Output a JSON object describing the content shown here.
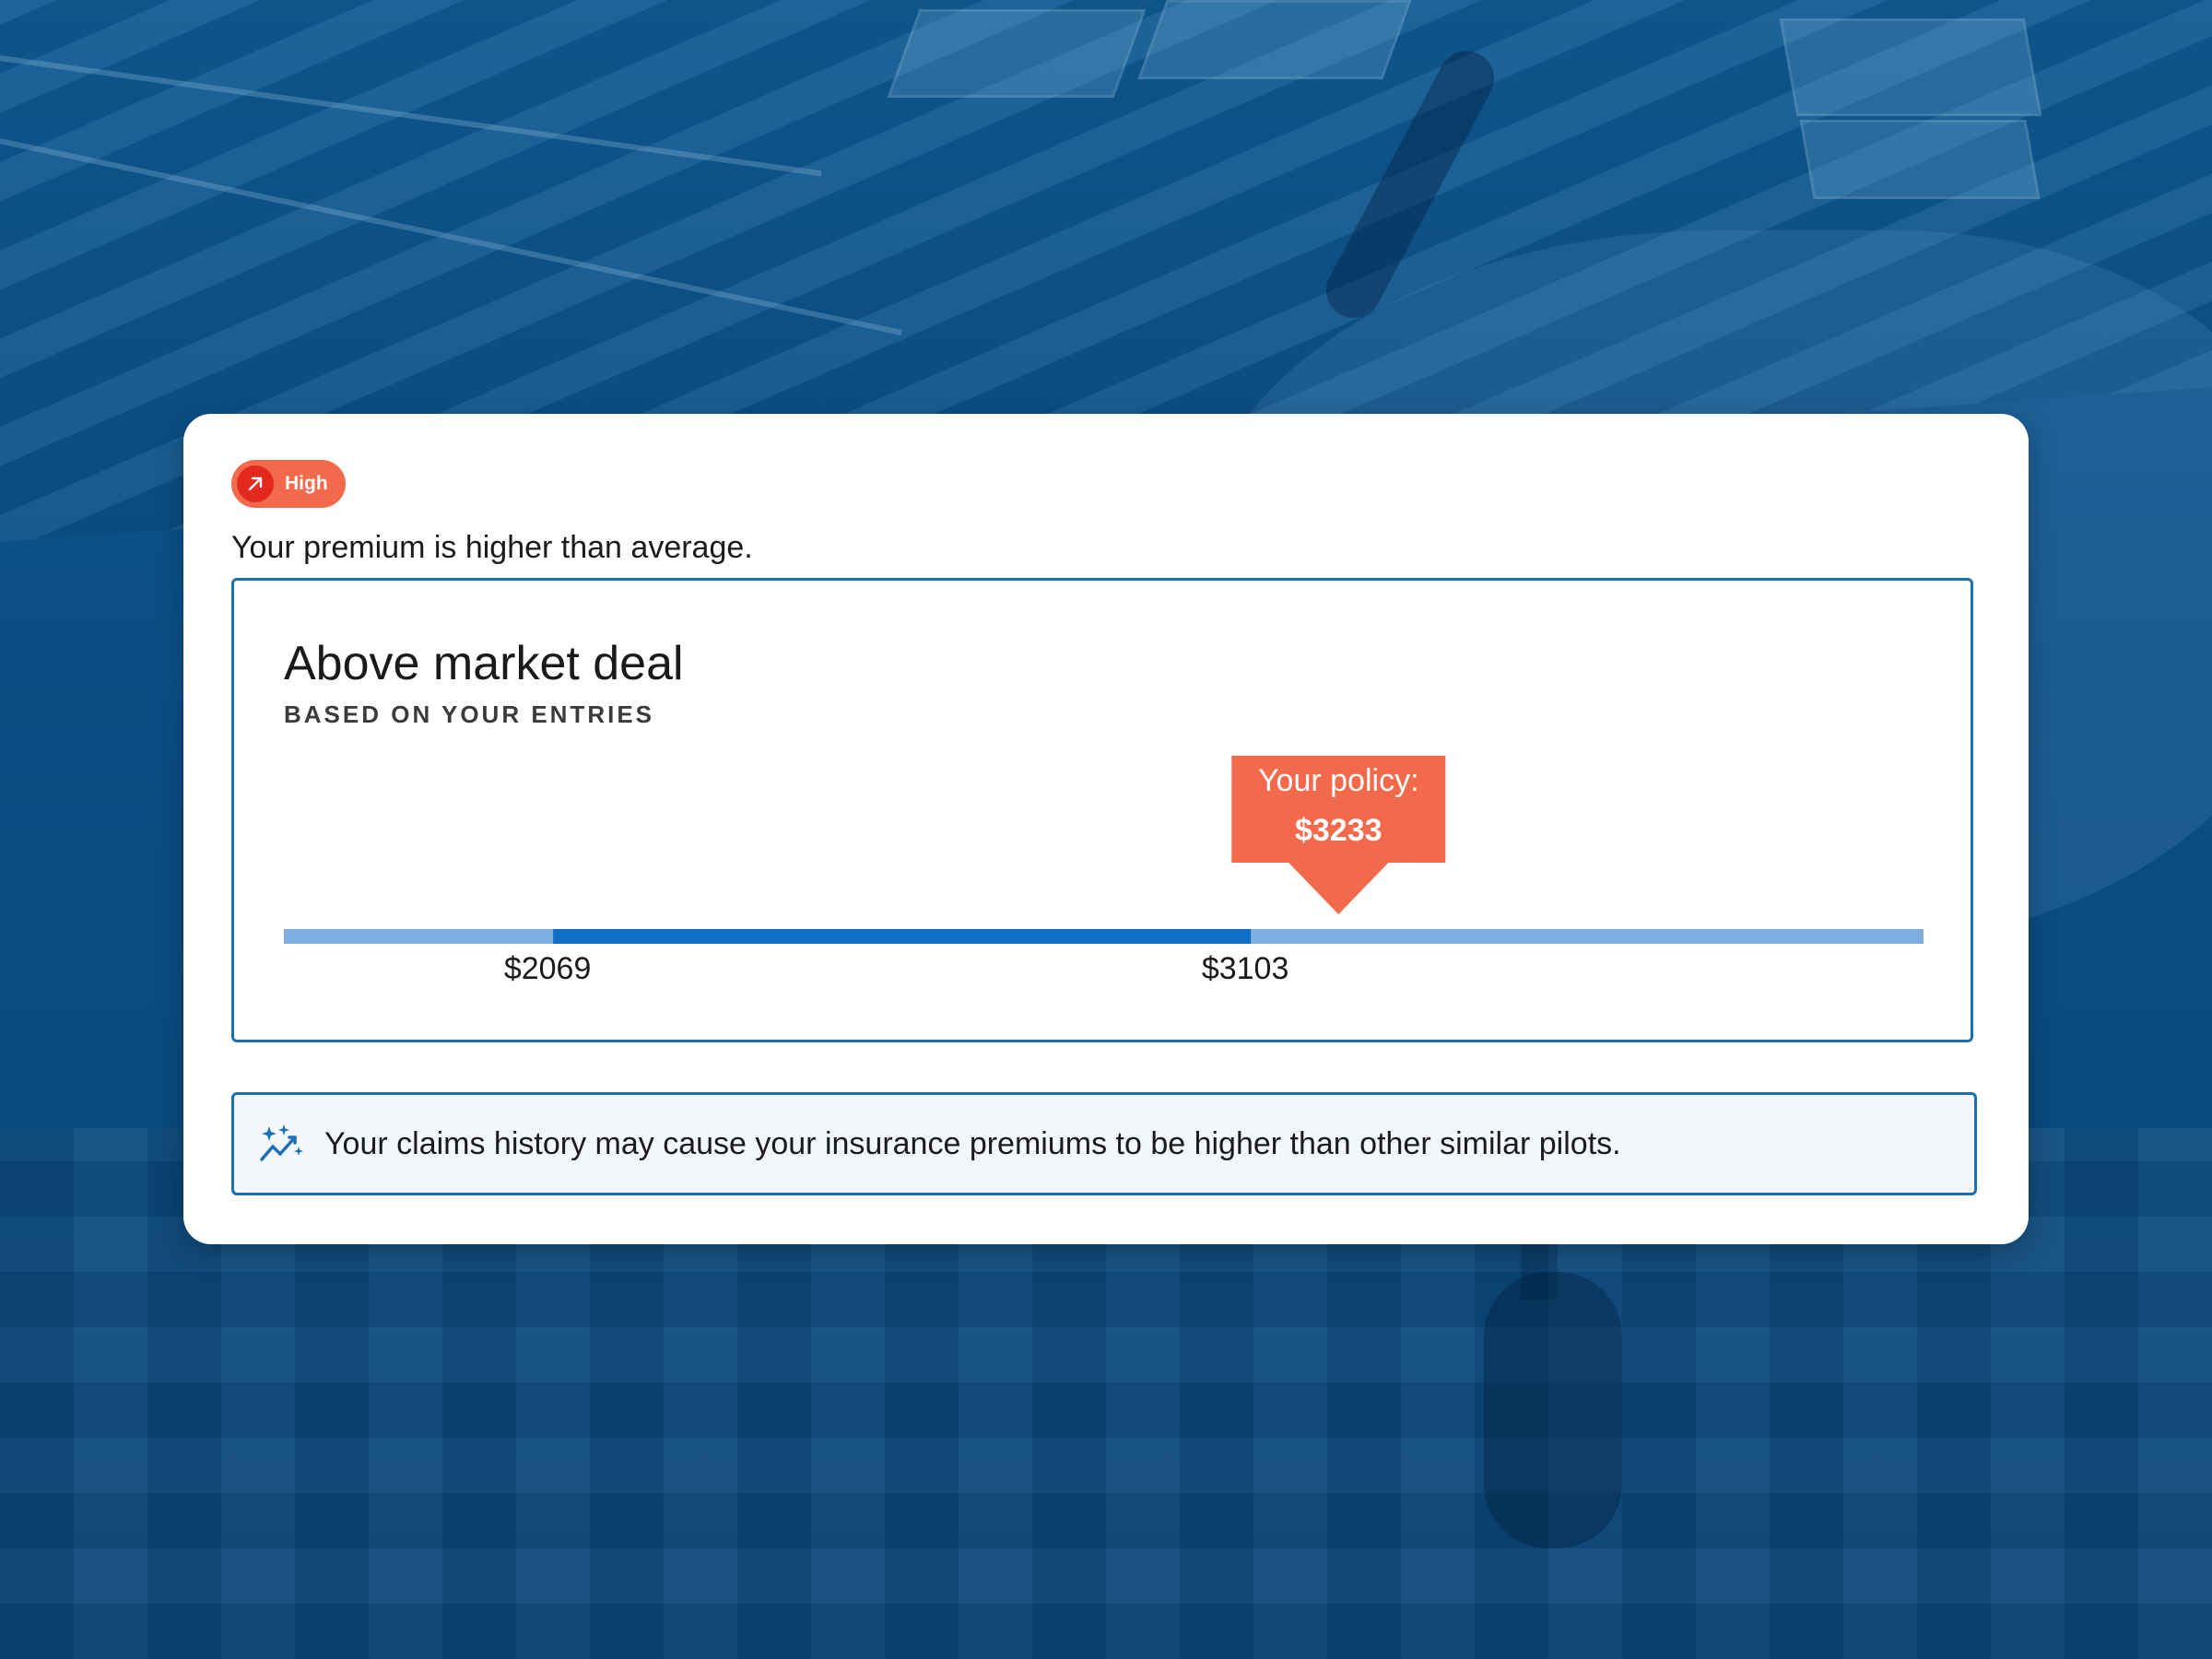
{
  "badge": {
    "label": "High",
    "color": "#f26a4b",
    "icon": "arrow-up-right-icon"
  },
  "intro_text": "Your premium is higher than average.",
  "chart": {
    "title": "Above market deal",
    "subtitle": "BASED ON YOUR ENTRIES",
    "colors": {
      "track": "#7eaee0",
      "range": "#0f6fc8",
      "marker": "#f26a4b"
    }
  },
  "chart_data": {
    "type": "range-bar",
    "range_low": 2069,
    "range_high": 3103,
    "range_labels": [
      "$2069",
      "$3103"
    ],
    "policy_value": 3233,
    "policy_label": "Your policy:",
    "policy_value_label": "$3233",
    "xlim": [
      1670,
      4100
    ]
  },
  "note": {
    "icon": "sparkle-trend-icon",
    "text": "Your claims history may cause your insurance premiums to be higher than other similar pilots."
  }
}
